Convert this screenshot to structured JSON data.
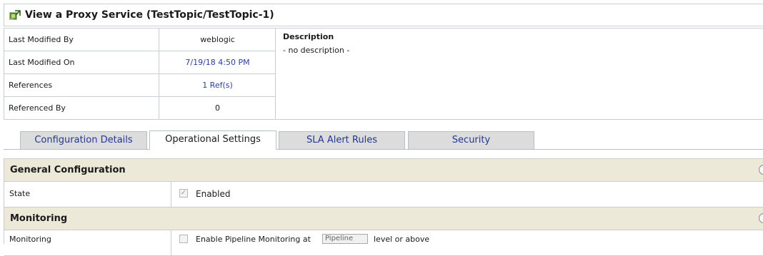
{
  "title": {
    "text": "View a Proxy Service (TestTopic/TestTopic-1)",
    "icon": "proxy-service-icon"
  },
  "summary": {
    "rows": [
      {
        "label": "Last Modified By",
        "value": "weblogic"
      },
      {
        "label": "Last Modified On",
        "value": "7/19/18 4:50 PM"
      },
      {
        "label": "References",
        "value": "1 Ref(s)"
      },
      {
        "label": "Referenced By",
        "value": "0"
      }
    ],
    "description_label": "Description",
    "description_value": "- no description -"
  },
  "tabs": [
    {
      "label": "Configuration Details",
      "active": false
    },
    {
      "label": "Operational Settings",
      "active": true
    },
    {
      "label": "SLA Alert Rules",
      "active": false
    },
    {
      "label": "Security",
      "active": false
    }
  ],
  "sections": {
    "general": {
      "title": "General Configuration",
      "state_label": "State",
      "state_value": "Enabled",
      "state_checked": true
    },
    "monitoring": {
      "title": "Monitoring",
      "row_label": "Monitoring",
      "enable_text": "Enable Pipeline Monitoring at",
      "level_option": "Pipeline",
      "suffix_text": "level or above"
    }
  },
  "colors": {
    "link": "#2a3f9d",
    "tab_inactive_bg": "#dcdcdc",
    "section_header_bg": "#ece9d8",
    "border": "#c9ced6"
  }
}
